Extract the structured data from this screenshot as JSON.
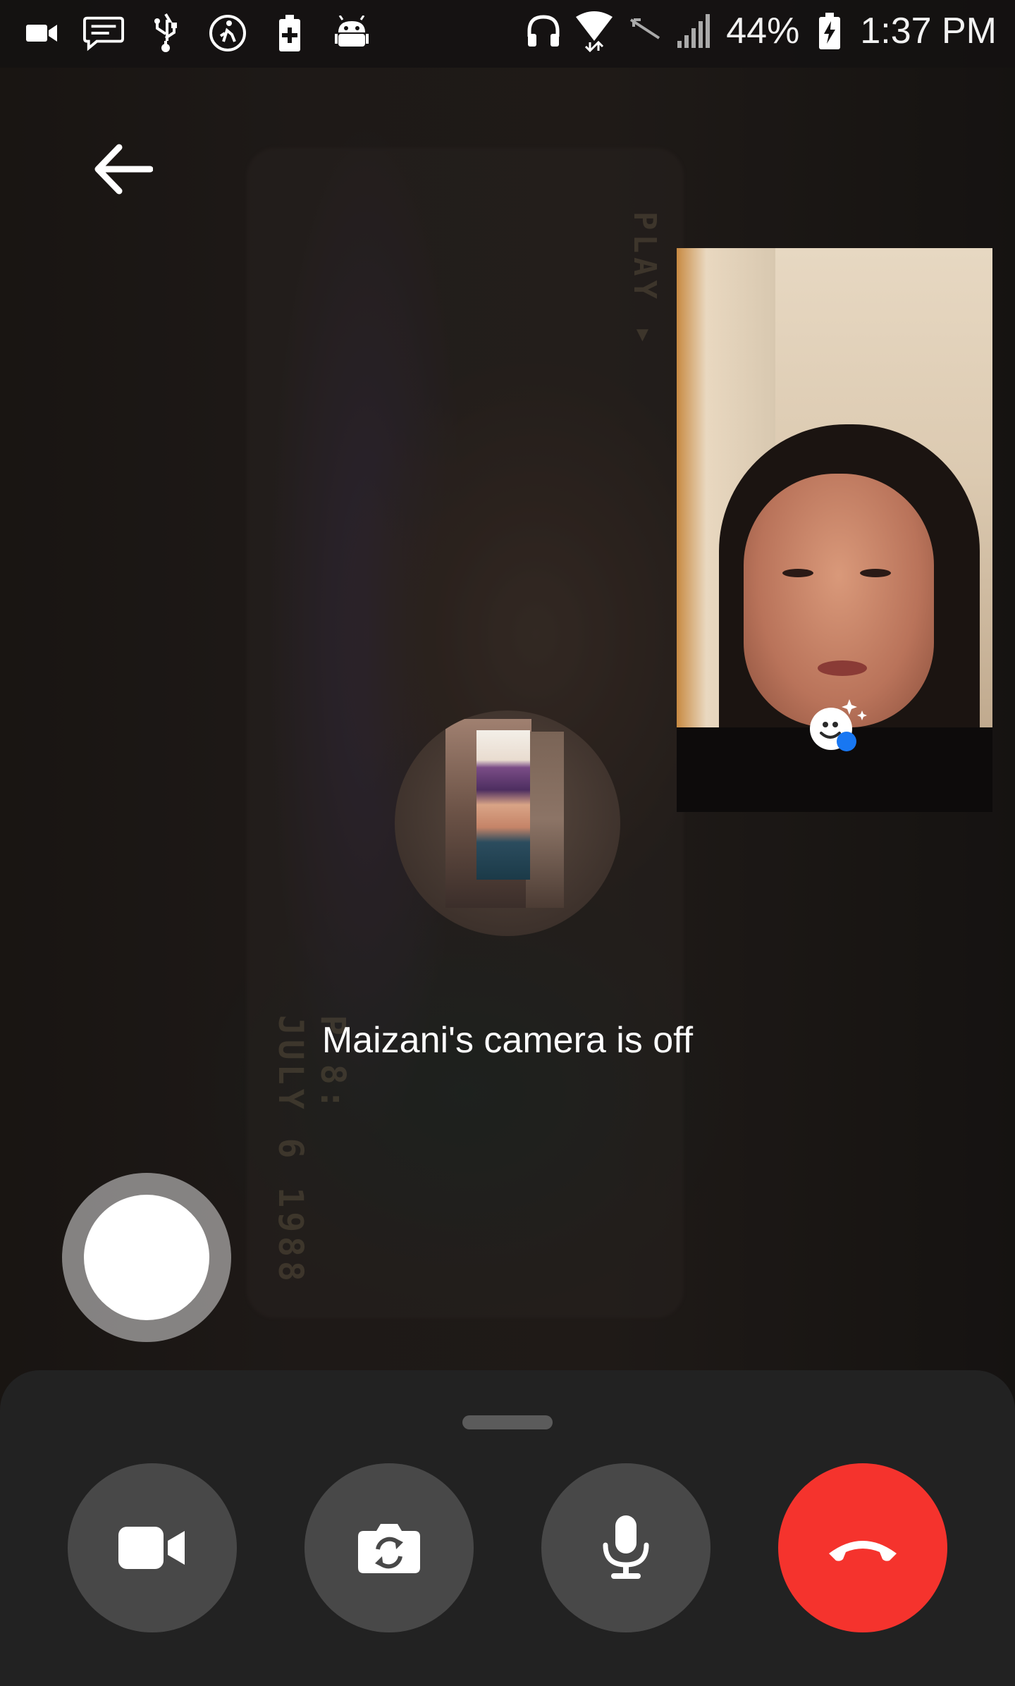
{
  "status_bar": {
    "battery_percent": "44%",
    "time": "1:37 PM",
    "left_icons": [
      "video-camera-icon",
      "message-icon",
      "usb-icon",
      "accessibility-icon",
      "battery-plus-icon",
      "android-icon"
    ],
    "right_icons": [
      "headphones-icon",
      "wifi-icon",
      "no-signal-icon",
      "cellular-signal-icon",
      "battery-charging-icon"
    ]
  },
  "call": {
    "camera_off_message": "Maizani's camera is off"
  },
  "remote_photo_text": {
    "play": "PLAY ▸",
    "date": "JULY 6 1988",
    "time": "P 8:"
  },
  "controls": {
    "buttons": [
      "video-toggle",
      "switch-camera",
      "microphone",
      "end-call"
    ]
  },
  "colors": {
    "end_call": "#f5332d",
    "control_bg": "#484848",
    "sheet_bg": "#222222",
    "effects_badge": "#1877f2"
  }
}
